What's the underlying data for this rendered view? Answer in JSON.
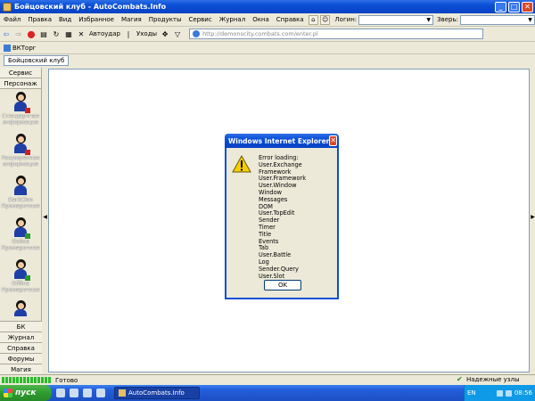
{
  "window": {
    "title": "Бойцовский клуб - AutoCombats.Info"
  },
  "menu": {
    "items": [
      "Файл",
      "Правка",
      "Вид",
      "Избранное",
      "Магия",
      "Продукты",
      "Сервис",
      "Журнал",
      "Окна",
      "Справка"
    ],
    "login_label": "Логин:",
    "beast_label": "Зверь:"
  },
  "toolbar": {
    "autoudar": "Автоудар",
    "uhoty": "Уходы",
    "address": "http://demonscity.combats.com/enter.pl"
  },
  "links": {
    "item": "ВКТорг"
  },
  "tabs": {
    "active": "Бойцовский клуб"
  },
  "sidebar": {
    "top": [
      "Сервис",
      "Персонаж"
    ],
    "items": [
      {
        "label": "Стандартная информация",
        "badge": "red"
      },
      {
        "label": "Расширенная информация",
        "badge": "red"
      },
      {
        "label": "DarkClan Примерочная",
        "badge": "none"
      },
      {
        "label": "Online Примерочная",
        "badge": "green"
      },
      {
        "label": "Offline Примерочная",
        "badge": "green"
      }
    ],
    "bottom": [
      "БК",
      "Журнал",
      "Справка",
      "Форумы",
      "Магия"
    ]
  },
  "dialog": {
    "title": "Windows Internet Explorer",
    "message": [
      "Error loading: User.Exchange",
      "Framework",
      "User.Framework",
      "User.Window",
      "Window",
      "Messages",
      "DOM",
      "User.TopEdit",
      "Sender",
      "Timer",
      "Title",
      "Events",
      "Tab",
      "User.Battle",
      "Log",
      "Sender.Query",
      "User.Slot"
    ],
    "ok_label": "OK"
  },
  "status": {
    "text": "Готово",
    "zone": "Надежные узлы",
    "progress_segments": 14
  },
  "taskbar": {
    "start": "пуск",
    "task": "AutoCombats.Info",
    "lang": "EN",
    "clock": "08:56"
  }
}
